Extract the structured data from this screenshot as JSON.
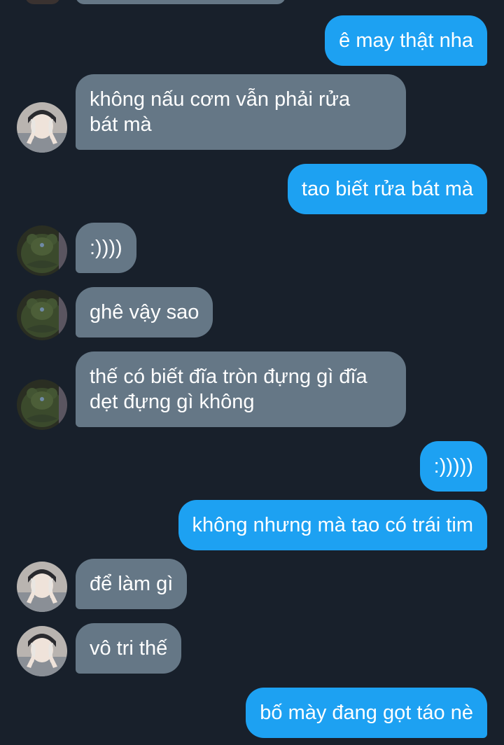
{
  "colors": {
    "background": "#18202b",
    "incoming_bubble": "#657786",
    "outgoing_bubble": "#1da1f2",
    "text": "#ffffff"
  },
  "messages": [
    {
      "dir": "out",
      "text": "ê may thật nha"
    },
    {
      "dir": "in",
      "avatar": "avatar-person-icon",
      "text": "không nấu cơm vẫn phải rửa\nbát mà"
    },
    {
      "dir": "out",
      "text": "tao biết rửa bát mà"
    },
    {
      "dir": "in",
      "avatar": "avatar-bear-icon",
      "text": ":))))"
    },
    {
      "dir": "in",
      "avatar": "avatar-bear-icon",
      "text": "ghê vậy sao"
    },
    {
      "dir": "in",
      "avatar": "avatar-bear-icon",
      "text": "thế có biết đĩa tròn đựng gì đĩa\ndẹt đựng gì không"
    },
    {
      "dir": "out",
      "text": ":)))))"
    },
    {
      "dir": "out",
      "text": "không nhưng mà tao có trái tim"
    },
    {
      "dir": "in",
      "avatar": "avatar-person-icon",
      "text": "để làm gì"
    },
    {
      "dir": "in",
      "avatar": "avatar-person-icon",
      "text": "vô tri thế"
    },
    {
      "dir": "out",
      "text": "bố mày đang gọt táo nè"
    }
  ]
}
